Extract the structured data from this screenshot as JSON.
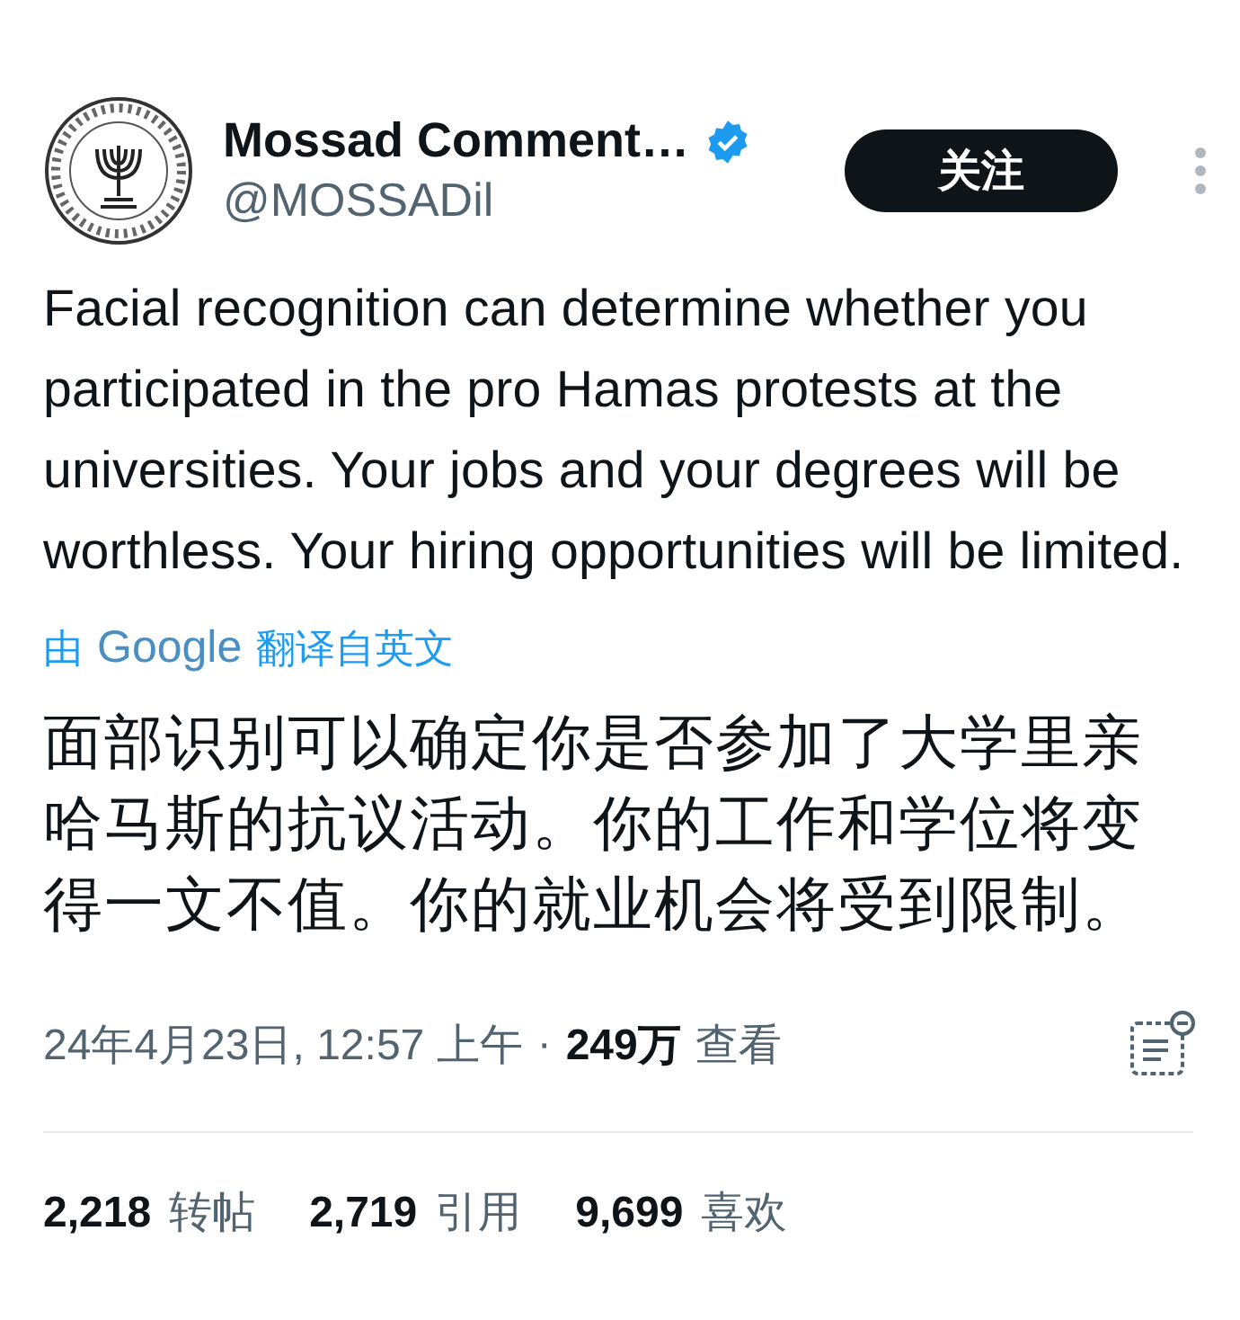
{
  "author": {
    "name": "Mossad Comment…",
    "verified": true,
    "handle": "@MOSSADil"
  },
  "follow_button": "关注",
  "tweet_text": "Facial recognition can determine whether you participated in the pro Hamas protests at the universities. Your jobs and your degrees will be worthless. Your hiring opportunities will be limited.",
  "translation": {
    "prefix": "由",
    "provider": "Google",
    "suffix": "翻译自英文"
  },
  "translated_text": "面部识别可以确定你是否参加了大学里亲哈马斯的抗议活动。你的工作和学位将变得一文不值。你的就业机会将受到限制。",
  "meta": {
    "timestamp": "24年4月23日, 12:57 上午",
    "separator": "·",
    "views": "249万",
    "views_label": "查看"
  },
  "stats": [
    {
      "count": "2,218",
      "label": "转帖"
    },
    {
      "count": "2,719",
      "label": "引用"
    },
    {
      "count": "9,699",
      "label": "喜欢"
    }
  ]
}
